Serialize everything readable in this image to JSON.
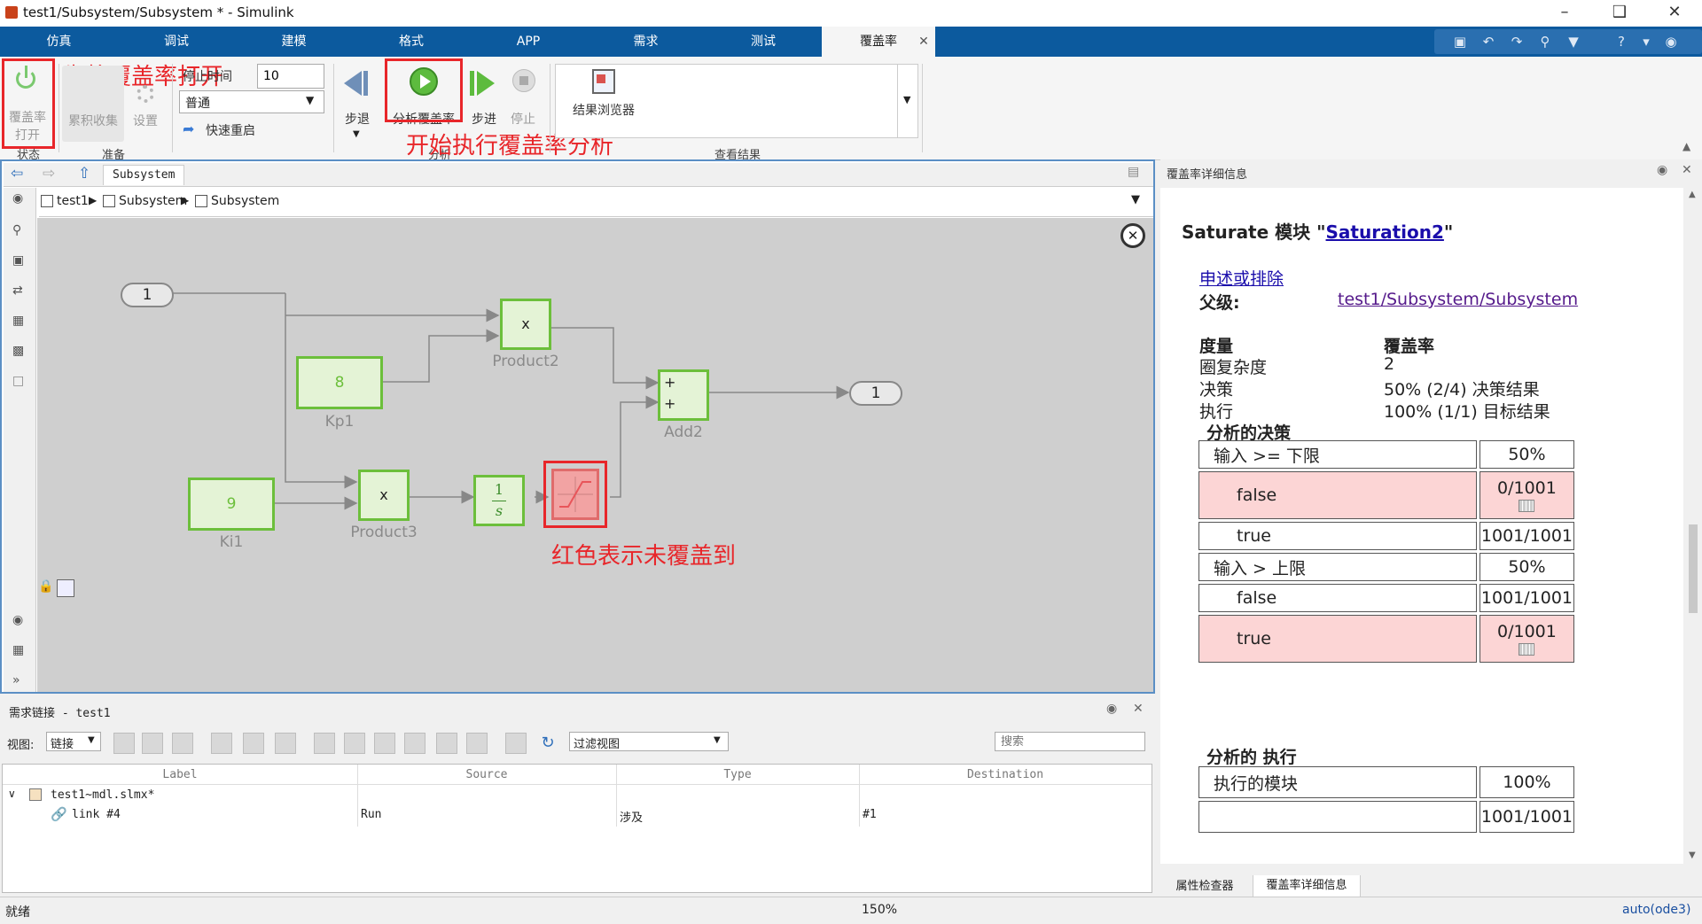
{
  "window": {
    "title": "test1/Subsystem/Subsystem * - Simulink"
  },
  "tabs": [
    "仿真",
    "调试",
    "建模",
    "格式",
    "APP",
    "需求",
    "测试",
    "覆盖率"
  ],
  "ribbon": {
    "coverage_toggle_label_1": "覆盖率",
    "coverage_toggle_label_2": "打开",
    "accumulate_label": "累积收集",
    "settings_label": "设置",
    "stop_time_label": "停止时间",
    "stop_time_value": "10",
    "sim_mode": "普通",
    "fast_restart_label": "快速重启",
    "step_back_label": "步退",
    "analyze_label": "分析覆盖率",
    "step_forward_label": "步进",
    "stop_label": "停止",
    "results_browser_label": "结果浏览器",
    "groups": {
      "status": "状态",
      "prepare": "准备",
      "analyze": "分析",
      "results": "查看结果"
    },
    "annotation_on": "先将覆盖率打开",
    "annotation_analyze": "开始执行覆盖率分析"
  },
  "editor": {
    "tab": "Subsystem",
    "breadcrumb": [
      "test1",
      "Subsystem",
      "Subsystem"
    ],
    "annotation_red": "红色表示未覆盖到"
  },
  "blocks": {
    "inport": "1",
    "outport": "1",
    "kp_value": "8",
    "kp_label": "Kp1",
    "ki_value": "9",
    "ki_label": "Ki1",
    "product2_sym": "x",
    "product2_label": "Product2",
    "product3_sym": "x",
    "product3_label": "Product3",
    "add_label": "Add2",
    "add_plus": "+",
    "integrator_num": "1",
    "integrator_den": "s"
  },
  "coverage": {
    "panel_title": "覆盖率详细信息",
    "heading_prefix": "Saturate 模块 \"",
    "heading_link": "Saturation2",
    "heading_suffix": "\"",
    "justify_link": "申述或排除",
    "parent_label": "父级:",
    "parent_link": "test1/Subsystem/Subsystem",
    "metric_header": "度量",
    "coverage_header": "覆盖率",
    "metrics": [
      {
        "name": "圈复杂度",
        "value": "2"
      },
      {
        "name": "决策",
        "value": "50% (2/4) 决策结果"
      },
      {
        "name": "执行",
        "value": "100% (1/1) 目标结果"
      }
    ],
    "decisions_title": "分析的决策",
    "decision_rows": [
      {
        "label": "输入 >= 下限",
        "value": "50%",
        "indent": false,
        "red": false
      },
      {
        "label": "false",
        "value": "0/1001",
        "indent": true,
        "red": true
      },
      {
        "label": "true",
        "value": "1001/1001",
        "indent": true,
        "red": false
      },
      {
        "label": "输入 > 上限",
        "value": "50%",
        "indent": false,
        "red": false
      },
      {
        "label": "false",
        "value": "1001/1001",
        "indent": true,
        "red": false
      },
      {
        "label": "true",
        "value": "0/1001",
        "indent": true,
        "red": true
      }
    ],
    "exec_title": "分析的 执行",
    "exec_rows": [
      {
        "label": "执行的模块",
        "value": "100%"
      },
      {
        "label": "",
        "value": "1001/1001"
      }
    ],
    "bottom_tabs": [
      "属性检查器",
      "覆盖率详细信息"
    ]
  },
  "requirements": {
    "title": "需求链接 - test1",
    "view_label": "视图:",
    "view_value": "链接",
    "filter_value": "过滤视图",
    "search_placeholder": "搜索",
    "columns": [
      "Label",
      "Source",
      "Type",
      "Destination"
    ],
    "root": "test1~mdl.slmx*",
    "link": {
      "label": "link #4",
      "source": "Run",
      "type": "涉及",
      "destination": "#1"
    }
  },
  "status": {
    "left": "就绪",
    "zoom": "150%",
    "solver": "auto(ode3)"
  },
  "colors": {
    "tabbar": "#0c5a9e",
    "annotation": "#e8262a",
    "block_border": "#6cbf3b",
    "uncovered": "#fcd5d5"
  }
}
